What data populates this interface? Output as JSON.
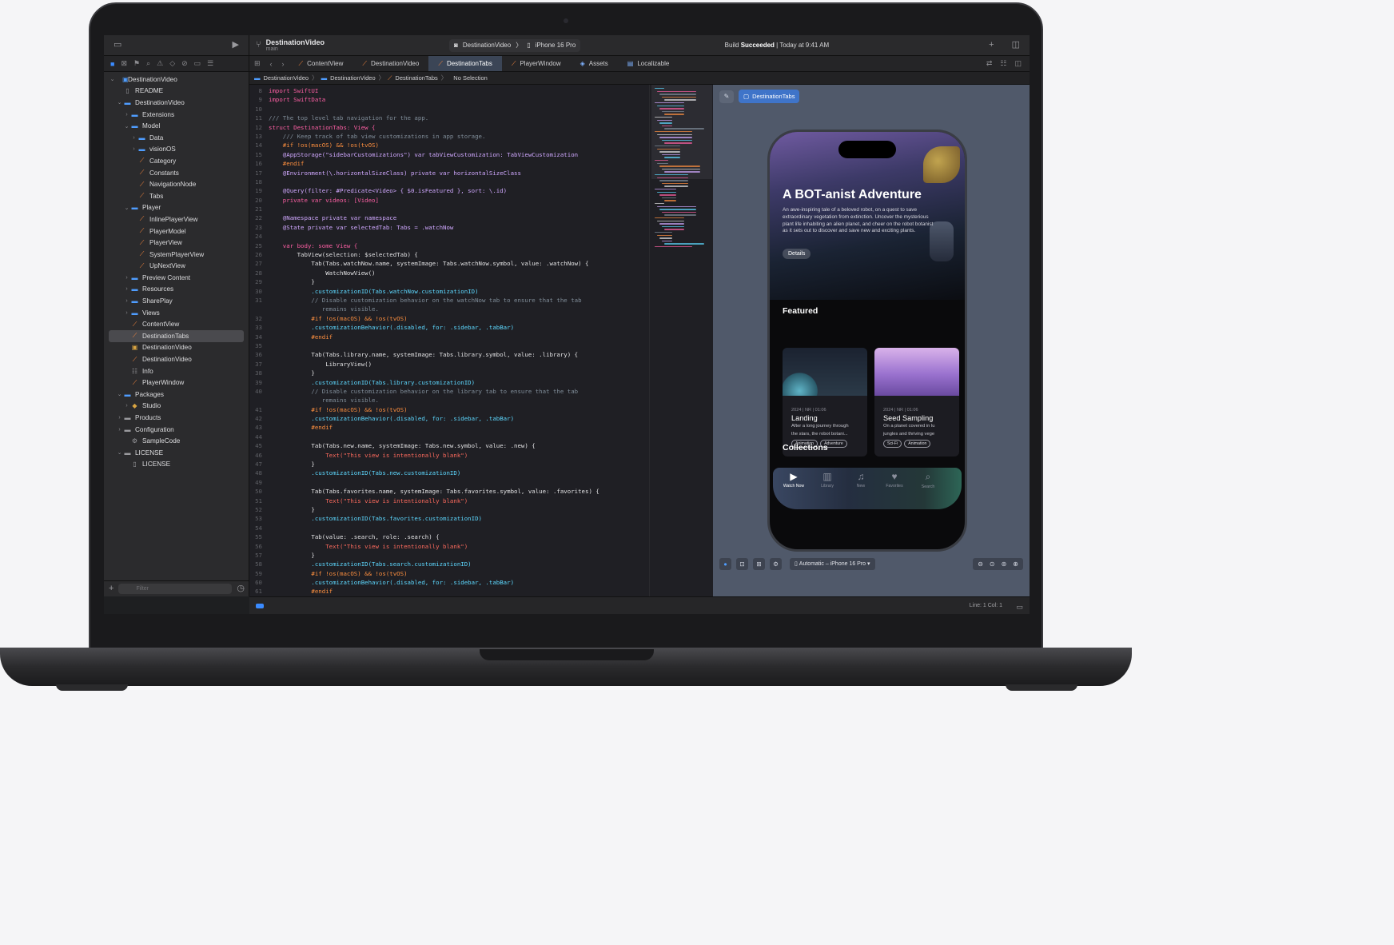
{
  "toolbar": {
    "project_name": "DestinationVideo",
    "branch": "main",
    "scheme": "DestinationVideo",
    "destination": "iPhone 16 Pro",
    "build_status_prefix": "Build",
    "build_status_word": "Succeeded",
    "build_status_time": "| Today at 9:41 AM"
  },
  "tabs": [
    {
      "label": "ContentView",
      "icon": "swift-file-icon"
    },
    {
      "label": "DestinationVideo",
      "icon": "swift-file-icon"
    },
    {
      "label": "DestinationTabs",
      "icon": "swift-file-icon",
      "active": true
    },
    {
      "label": "PlayerWindow",
      "icon": "swift-file-icon"
    },
    {
      "label": "Assets",
      "icon": "asset-catalog-icon"
    },
    {
      "label": "Localizable",
      "icon": "strings-icon"
    }
  ],
  "navigator": {
    "items": [
      {
        "label": "DestinationVideo",
        "icon": "project-icon",
        "indent": 0,
        "chevron": "down"
      },
      {
        "label": "README",
        "icon": "doc-icon",
        "indent": 1,
        "chevron": ""
      },
      {
        "label": "DestinationVideo",
        "icon": "folder-icon",
        "indent": 1,
        "chevron": "down"
      },
      {
        "label": "Extensions",
        "icon": "folder-icon",
        "indent": 2,
        "chevron": "right"
      },
      {
        "label": "Model",
        "icon": "folder-icon",
        "indent": 2,
        "chevron": "down"
      },
      {
        "label": "Data",
        "icon": "folder-icon",
        "indent": 3,
        "chevron": "right"
      },
      {
        "label": "visionOS",
        "icon": "folder-icon",
        "indent": 3,
        "chevron": "right"
      },
      {
        "label": "Category",
        "icon": "swift-icon",
        "indent": 3,
        "chevron": ""
      },
      {
        "label": "Constants",
        "icon": "swift-icon",
        "indent": 3,
        "chevron": ""
      },
      {
        "label": "NavigationNode",
        "icon": "swift-icon",
        "indent": 3,
        "chevron": ""
      },
      {
        "label": "Tabs",
        "icon": "swift-icon",
        "indent": 3,
        "chevron": ""
      },
      {
        "label": "Player",
        "icon": "folder-icon",
        "indent": 2,
        "chevron": "down"
      },
      {
        "label": "InlinePlayerView",
        "icon": "swift-icon",
        "indent": 3,
        "chevron": ""
      },
      {
        "label": "PlayerModel",
        "icon": "swift-icon",
        "indent": 3,
        "chevron": ""
      },
      {
        "label": "PlayerView",
        "icon": "swift-icon",
        "indent": 3,
        "chevron": ""
      },
      {
        "label": "SystemPlayerView",
        "icon": "swift-icon",
        "indent": 3,
        "chevron": ""
      },
      {
        "label": "UpNextView",
        "icon": "swift-icon",
        "indent": 3,
        "chevron": ""
      },
      {
        "label": "Preview Content",
        "icon": "folder-icon",
        "indent": 2,
        "chevron": "right"
      },
      {
        "label": "Resources",
        "icon": "folder-icon",
        "indent": 2,
        "chevron": "right"
      },
      {
        "label": "SharePlay",
        "icon": "folder-icon",
        "indent": 2,
        "chevron": "right"
      },
      {
        "label": "Views",
        "icon": "folder-icon",
        "indent": 2,
        "chevron": "right"
      },
      {
        "label": "ContentView",
        "icon": "swift-icon",
        "indent": 2,
        "chevron": ""
      },
      {
        "label": "DestinationTabs",
        "icon": "swift-icon",
        "indent": 2,
        "chevron": "",
        "selected": true
      },
      {
        "label": "DestinationVideo",
        "icon": "app-icon",
        "indent": 2,
        "chevron": ""
      },
      {
        "label": "DestinationVideo",
        "icon": "swift-icon",
        "indent": 2,
        "chevron": ""
      },
      {
        "label": "Info",
        "icon": "plist-icon",
        "indent": 2,
        "chevron": ""
      },
      {
        "label": "PlayerWindow",
        "icon": "swift-icon",
        "indent": 2,
        "chevron": ""
      },
      {
        "label": "Packages",
        "icon": "folder-icon",
        "indent": 1,
        "chevron": "down"
      },
      {
        "label": "Studio",
        "icon": "package-icon",
        "indent": 2,
        "chevron": "right"
      },
      {
        "label": "Products",
        "icon": "gray-folder-icon",
        "indent": 1,
        "chevron": "right"
      },
      {
        "label": "Configuration",
        "icon": "gray-folder-icon",
        "indent": 1,
        "chevron": "right"
      },
      {
        "label": "SampleCode",
        "icon": "config-icon",
        "indent": 2,
        "chevron": ""
      },
      {
        "label": "LICENSE",
        "icon": "gray-folder-icon",
        "indent": 1,
        "chevron": "down"
      },
      {
        "label": "LICENSE",
        "icon": "doc-icon",
        "indent": 2,
        "chevron": ""
      }
    ],
    "filter_placeholder": "Filter"
  },
  "jump_bar": [
    "DestinationVideo",
    "DestinationVideo",
    "DestinationTabs",
    "No Selection"
  ],
  "code_lines": [
    {
      "n": "8",
      "t": "import SwiftUI"
    },
    {
      "n": "9",
      "t": "import SwiftData"
    },
    {
      "n": "10",
      "t": ""
    },
    {
      "n": "11",
      "t": "/// The top level tab navigation for the app."
    },
    {
      "n": "12",
      "t": "struct DestinationTabs: View {"
    },
    {
      "n": "13",
      "t": "    /// Keep track of tab view customizations in app storage."
    },
    {
      "n": "14",
      "t": "    #if !os(macOS) && !os(tvOS)"
    },
    {
      "n": "15",
      "t": "    @AppStorage(\"sidebarCustomizations\") var tabViewCustomization: TabViewCustomization"
    },
    {
      "n": "16",
      "t": "    #endif"
    },
    {
      "n": "17",
      "t": "    @Environment(\\.horizontalSizeClass) private var horizontalSizeClass"
    },
    {
      "n": "18",
      "t": ""
    },
    {
      "n": "19",
      "t": "    @Query(filter: #Predicate<Video> { $0.isFeatured }, sort: \\.id)"
    },
    {
      "n": "20",
      "t": "    private var videos: [Video]"
    },
    {
      "n": "21",
      "t": ""
    },
    {
      "n": "22",
      "t": "    @Namespace private var namespace"
    },
    {
      "n": "23",
      "t": "    @State private var selectedTab: Tabs = .watchNow"
    },
    {
      "n": "24",
      "t": ""
    },
    {
      "n": "25",
      "t": "    var body: some View {"
    },
    {
      "n": "26",
      "t": "        TabView(selection: $selectedTab) {"
    },
    {
      "n": "27",
      "t": "            Tab(Tabs.watchNow.name, systemImage: Tabs.watchNow.symbol, value: .watchNow) {"
    },
    {
      "n": "28",
      "t": "                WatchNowView()"
    },
    {
      "n": "29",
      "t": "            }"
    },
    {
      "n": "30",
      "t": "            .customizationID(Tabs.watchNow.customizationID)"
    },
    {
      "n": "31",
      "t": "            // Disable customization behavior on the watchNow tab to ensure that the tab"
    },
    {
      "n": "",
      "t": "               remains visible."
    },
    {
      "n": "32",
      "t": "            #if !os(macOS) && !os(tvOS)"
    },
    {
      "n": "33",
      "t": "            .customizationBehavior(.disabled, for: .sidebar, .tabBar)"
    },
    {
      "n": "34",
      "t": "            #endif"
    },
    {
      "n": "35",
      "t": ""
    },
    {
      "n": "36",
      "t": "            Tab(Tabs.library.name, systemImage: Tabs.library.symbol, value: .library) {"
    },
    {
      "n": "37",
      "t": "                LibraryView()"
    },
    {
      "n": "38",
      "t": "            }"
    },
    {
      "n": "39",
      "t": "            .customizationID(Tabs.library.customizationID)"
    },
    {
      "n": "40",
      "t": "            // Disable customization behavior on the library tab to ensure that the tab"
    },
    {
      "n": "",
      "t": "               remains visible."
    },
    {
      "n": "41",
      "t": "            #if !os(macOS) && !os(tvOS)"
    },
    {
      "n": "42",
      "t": "            .customizationBehavior(.disabled, for: .sidebar, .tabBar)"
    },
    {
      "n": "43",
      "t": "            #endif"
    },
    {
      "n": "44",
      "t": ""
    },
    {
      "n": "45",
      "t": "            Tab(Tabs.new.name, systemImage: Tabs.new.symbol, value: .new) {"
    },
    {
      "n": "46",
      "t": "                Text(\"This view is intentionally blank\")"
    },
    {
      "n": "47",
      "t": "            }"
    },
    {
      "n": "48",
      "t": "            .customizationID(Tabs.new.customizationID)"
    },
    {
      "n": "49",
      "t": ""
    },
    {
      "n": "50",
      "t": "            Tab(Tabs.favorites.name, systemImage: Tabs.favorites.symbol, value: .favorites) {"
    },
    {
      "n": "51",
      "t": "                Text(\"This view is intentionally blank\")"
    },
    {
      "n": "52",
      "t": "            }"
    },
    {
      "n": "53",
      "t": "            .customizationID(Tabs.favorites.customizationID)"
    },
    {
      "n": "54",
      "t": ""
    },
    {
      "n": "55",
      "t": "            Tab(value: .search, role: .search) {"
    },
    {
      "n": "56",
      "t": "                Text(\"This view is intentionally blank\")"
    },
    {
      "n": "57",
      "t": "            }"
    },
    {
      "n": "58",
      "t": "            .customizationID(Tabs.search.customizationID)"
    },
    {
      "n": "59",
      "t": "            #if !os(macOS) && !os(tvOS)"
    },
    {
      "n": "60",
      "t": "            .customizationBehavior(.disabled, for: .sidebar, .tabBar)"
    },
    {
      "n": "61",
      "t": "            #endif"
    }
  ],
  "preview": {
    "chip_label": "DestinationTabs",
    "hero_title": "A BOT-anist Adventure",
    "hero_desc": "An awe-inspiring tale of a beloved robot, on a quest to save extraordinary vegetation from extinction. Uncover the mysterious plant life inhabiting an alien planet, and cheer on the robot botanist as it sets out to discover and save new and exciting plants.",
    "hero_button": "Details",
    "featured_label": "Featured",
    "collections_label": "Collections",
    "cards": [
      {
        "meta": "2024 | NR | 01:06",
        "title": "Landing",
        "desc1": "After a long journey through",
        "desc2": "the stars, the robot botani...",
        "tags": [
          "Animation",
          "Adventure"
        ]
      },
      {
        "meta": "2024 | NR | 01:06",
        "title": "Seed Sampling",
        "desc1": "On a planet covered in lu",
        "desc2": "jungles and thriving vege",
        "tags": [
          "Sci-Fi",
          "Animation"
        ]
      }
    ],
    "tab_items": [
      {
        "label": "Watch Now",
        "icon": "play-icon",
        "active": true
      },
      {
        "label": "Library",
        "icon": "library-icon"
      },
      {
        "label": "New",
        "icon": "bell-icon"
      },
      {
        "label": "Favorites",
        "icon": "heart-icon"
      },
      {
        "label": "Search",
        "icon": "search-icon"
      }
    ],
    "device_label": "Automatic – iPhone 16 Pro"
  },
  "status_bar": {
    "line_col": "Line: 1  Col: 1"
  },
  "colors": {
    "accent": "#3a8bff",
    "keyword": "#fc5fa3",
    "type": "#5dd8ff",
    "string": "#fc6a5d",
    "comment": "#7f8c98",
    "preproc": "#fd8f3f"
  }
}
